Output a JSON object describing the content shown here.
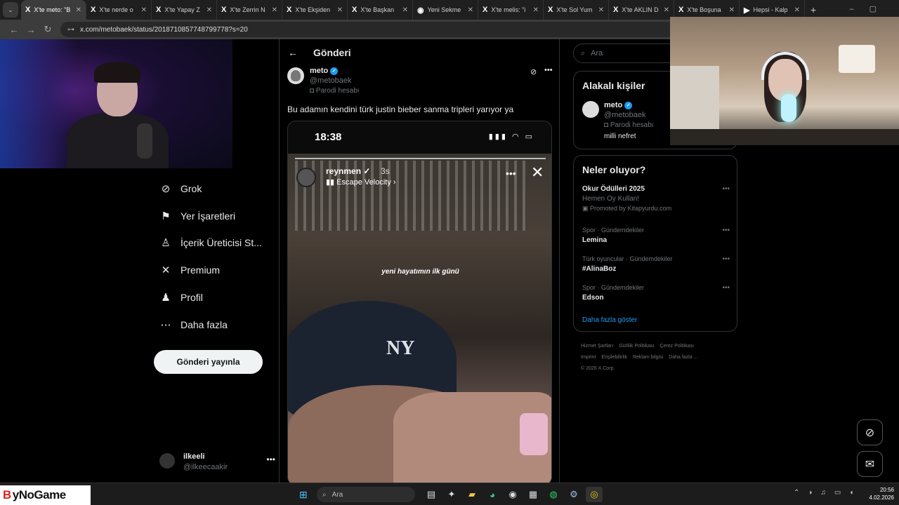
{
  "browser": {
    "tabs": [
      {
        "icon": "X",
        "label": "X'te meto: \"B",
        "active": true
      },
      {
        "icon": "X",
        "label": "X'te nerde o"
      },
      {
        "icon": "X",
        "label": "X'te Yapay Z"
      },
      {
        "icon": "X",
        "label": "X'te Zerrin N"
      },
      {
        "icon": "X",
        "label": "X'te Ekşiden"
      },
      {
        "icon": "X",
        "label": "X'te Başkan"
      },
      {
        "icon": "◉",
        "label": "Yeni Sekme"
      },
      {
        "icon": "X",
        "label": "X'te melis: \"i"
      },
      {
        "icon": "X",
        "label": "X'te Sol Yum"
      },
      {
        "icon": "X",
        "label": "X'te AKLIN D"
      },
      {
        "icon": "X",
        "label": "X'te Boşuna"
      },
      {
        "icon": "▶",
        "label": "Hepsi - Kalp"
      }
    ],
    "url": "x.com/metobaek/status/2018710857748799778?s=20"
  },
  "nav": {
    "items": [
      {
        "icon": "grok-icon",
        "glyph": "⊘",
        "label": "Grok"
      },
      {
        "icon": "bookmark-icon",
        "glyph": "⚑",
        "label": "Yer İşaretleri"
      },
      {
        "icon": "creator-studio-icon",
        "glyph": "♙",
        "label": "İçerik Üreticisi St..."
      },
      {
        "icon": "x-premium-icon",
        "glyph": "✕",
        "label": "Premium"
      },
      {
        "icon": "profile-icon",
        "glyph": "♟",
        "label": "Profil"
      },
      {
        "icon": "more-icon",
        "glyph": "⋯",
        "label": "Daha fazla"
      }
    ],
    "post_button": "Gönderi yayınla",
    "account": {
      "name": "ilkeeli",
      "handle": "@ilkeecaakir"
    }
  },
  "post": {
    "header_title": "Gönderi",
    "author_name": "meto",
    "author_handle": "@metobaek",
    "parody_label": "Parodi hesabı",
    "text": "Bu adamın kendini türk justin bieber sanma tripleri yarıyor ya",
    "media": {
      "phone_time": "18:38",
      "story_user": "reynmen",
      "story_time": "3s",
      "story_music": "Escape Velocity",
      "story_caption": "yeni hayatımın ilk günü",
      "cap_logo": "NY"
    }
  },
  "sidebar": {
    "search_placeholder": "Ara",
    "related_title": "Alakalı kişiler",
    "related": {
      "name": "meto",
      "handle": "@metobaek",
      "parody": "Parodi hesabı",
      "bio": "milli nefret"
    },
    "trends_title": "Neler oluyor?",
    "trends": [
      {
        "context": "",
        "title": "Okur Ödülleri 2025",
        "sub": "Hemen Oy Kullan!",
        "promo": "Promoted by Kitapyurdu.com"
      },
      {
        "context": "Spor · Gündemdekiler",
        "title": "Lemina"
      },
      {
        "context": "Türk oyuncular · Gündemdekiler",
        "title": "#AlinaBoz"
      },
      {
        "context": "Spor · Gündemdekiler",
        "title": "Edson"
      }
    ],
    "show_more": "Daha fazla göster",
    "footer": [
      "Hizmet Şartları",
      "Gizlilik Politikası",
      "Çerez Politikası",
      "Imprint",
      "Erişilebilirlik",
      "Reklam bilgisi",
      "Daha fazla ...",
      "© 2026 X Corp."
    ]
  },
  "overlay": {
    "brand_b": "B",
    "brand_rest": "yNoGame"
  },
  "taskbar": {
    "search_placeholder": "Ara",
    "time": "20:56",
    "date": "4.02.2026",
    "badge": "17"
  }
}
